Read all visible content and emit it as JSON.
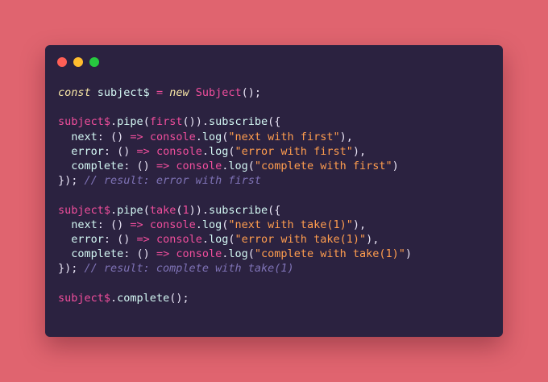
{
  "window": {
    "controls": [
      {
        "name": "close",
        "color": "#ff5f56"
      },
      {
        "name": "minimize",
        "color": "#ffbd2e"
      },
      {
        "name": "maximize",
        "color": "#27c93f"
      }
    ]
  },
  "code": {
    "lines": [
      [
        {
          "t": "kw",
          "v": "const"
        },
        {
          "t": "ws",
          "v": " "
        },
        {
          "t": "var",
          "v": "subject$"
        },
        {
          "t": "ws",
          "v": " "
        },
        {
          "t": "op",
          "v": "="
        },
        {
          "t": "ws",
          "v": " "
        },
        {
          "t": "kw",
          "v": "new"
        },
        {
          "t": "ws",
          "v": " "
        },
        {
          "t": "cls",
          "v": "Subject"
        },
        {
          "t": "punct",
          "v": "();"
        }
      ],
      [],
      [
        {
          "t": "id",
          "v": "subject$"
        },
        {
          "t": "punct",
          "v": "."
        },
        {
          "t": "fn",
          "v": "pipe"
        },
        {
          "t": "punct",
          "v": "("
        },
        {
          "t": "id",
          "v": "first"
        },
        {
          "t": "punct",
          "v": "())."
        },
        {
          "t": "fn",
          "v": "subscribe"
        },
        {
          "t": "punct",
          "v": "({"
        }
      ],
      [
        {
          "t": "ws",
          "v": "  "
        },
        {
          "t": "prop",
          "v": "next"
        },
        {
          "t": "punct",
          "v": ": () "
        },
        {
          "t": "op",
          "v": "=>"
        },
        {
          "t": "ws",
          "v": " "
        },
        {
          "t": "id",
          "v": "console"
        },
        {
          "t": "punct",
          "v": "."
        },
        {
          "t": "fn",
          "v": "log"
        },
        {
          "t": "punct",
          "v": "("
        },
        {
          "t": "str",
          "v": "\"next with first\""
        },
        {
          "t": "punct",
          "v": "),"
        }
      ],
      [
        {
          "t": "ws",
          "v": "  "
        },
        {
          "t": "prop",
          "v": "error"
        },
        {
          "t": "punct",
          "v": ": () "
        },
        {
          "t": "op",
          "v": "=>"
        },
        {
          "t": "ws",
          "v": " "
        },
        {
          "t": "id",
          "v": "console"
        },
        {
          "t": "punct",
          "v": "."
        },
        {
          "t": "fn",
          "v": "log"
        },
        {
          "t": "punct",
          "v": "("
        },
        {
          "t": "str",
          "v": "\"error with first\""
        },
        {
          "t": "punct",
          "v": "),"
        }
      ],
      [
        {
          "t": "ws",
          "v": "  "
        },
        {
          "t": "prop",
          "v": "complete"
        },
        {
          "t": "punct",
          "v": ": () "
        },
        {
          "t": "op",
          "v": "=>"
        },
        {
          "t": "ws",
          "v": " "
        },
        {
          "t": "id",
          "v": "console"
        },
        {
          "t": "punct",
          "v": "."
        },
        {
          "t": "fn",
          "v": "log"
        },
        {
          "t": "punct",
          "v": "("
        },
        {
          "t": "str",
          "v": "\"complete with first\""
        },
        {
          "t": "punct",
          "v": ")"
        }
      ],
      [
        {
          "t": "punct",
          "v": "}); "
        },
        {
          "t": "comment",
          "v": "// result: error with first"
        }
      ],
      [],
      [
        {
          "t": "id",
          "v": "subject$"
        },
        {
          "t": "punct",
          "v": "."
        },
        {
          "t": "fn",
          "v": "pipe"
        },
        {
          "t": "punct",
          "v": "("
        },
        {
          "t": "id",
          "v": "take"
        },
        {
          "t": "punct",
          "v": "("
        },
        {
          "t": "num",
          "v": "1"
        },
        {
          "t": "punct",
          "v": "))."
        },
        {
          "t": "fn",
          "v": "subscribe"
        },
        {
          "t": "punct",
          "v": "({"
        }
      ],
      [
        {
          "t": "ws",
          "v": "  "
        },
        {
          "t": "prop",
          "v": "next"
        },
        {
          "t": "punct",
          "v": ": () "
        },
        {
          "t": "op",
          "v": "=>"
        },
        {
          "t": "ws",
          "v": " "
        },
        {
          "t": "id",
          "v": "console"
        },
        {
          "t": "punct",
          "v": "."
        },
        {
          "t": "fn",
          "v": "log"
        },
        {
          "t": "punct",
          "v": "("
        },
        {
          "t": "str",
          "v": "\"next with take(1)\""
        },
        {
          "t": "punct",
          "v": "),"
        }
      ],
      [
        {
          "t": "ws",
          "v": "  "
        },
        {
          "t": "prop",
          "v": "error"
        },
        {
          "t": "punct",
          "v": ": () "
        },
        {
          "t": "op",
          "v": "=>"
        },
        {
          "t": "ws",
          "v": " "
        },
        {
          "t": "id",
          "v": "console"
        },
        {
          "t": "punct",
          "v": "."
        },
        {
          "t": "fn",
          "v": "log"
        },
        {
          "t": "punct",
          "v": "("
        },
        {
          "t": "str",
          "v": "\"error with take(1)\""
        },
        {
          "t": "punct",
          "v": "),"
        }
      ],
      [
        {
          "t": "ws",
          "v": "  "
        },
        {
          "t": "prop",
          "v": "complete"
        },
        {
          "t": "punct",
          "v": ": () "
        },
        {
          "t": "op",
          "v": "=>"
        },
        {
          "t": "ws",
          "v": " "
        },
        {
          "t": "id",
          "v": "console"
        },
        {
          "t": "punct",
          "v": "."
        },
        {
          "t": "fn",
          "v": "log"
        },
        {
          "t": "punct",
          "v": "("
        },
        {
          "t": "str",
          "v": "\"complete with take(1)\""
        },
        {
          "t": "punct",
          "v": ")"
        }
      ],
      [
        {
          "t": "punct",
          "v": "}); "
        },
        {
          "t": "comment",
          "v": "// result: complete with take(1)"
        }
      ],
      [],
      [
        {
          "t": "id",
          "v": "subject$"
        },
        {
          "t": "punct",
          "v": "."
        },
        {
          "t": "fn",
          "v": "complete"
        },
        {
          "t": "punct",
          "v": "();"
        }
      ]
    ]
  }
}
